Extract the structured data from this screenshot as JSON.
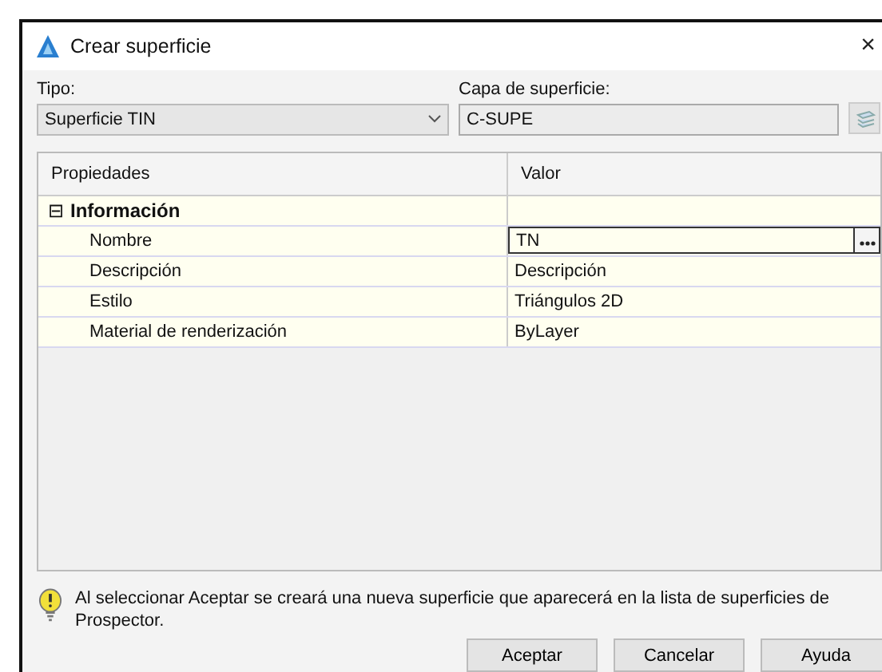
{
  "window": {
    "title": "Crear superficie",
    "close": "×"
  },
  "tipo": {
    "label": "Tipo:",
    "value": "Superficie TIN"
  },
  "capa": {
    "label": "Capa de superficie:",
    "value": "C-SUPE"
  },
  "grid": {
    "columns": [
      "Propiedades",
      "Valor"
    ],
    "groups": [
      {
        "name": "Información",
        "expanded": true,
        "expander": "⊟",
        "children": [
          {
            "name": "Nombre",
            "value": "TN",
            "selected": true
          },
          {
            "name": "Descripción",
            "value": "Descripción",
            "selected": false
          },
          {
            "name": "Estilo",
            "value": "Triángulos 2D",
            "selected": false
          },
          {
            "name": "Material de renderización",
            "value": "ByLayer",
            "selected": false
          }
        ]
      }
    ]
  },
  "note": "Al seleccionar Aceptar se creará una nueva superficie que aparecerá en la lista de superficies de Prospector.",
  "buttons": [
    "Aceptar",
    "Cancelar",
    "Ayuda"
  ]
}
